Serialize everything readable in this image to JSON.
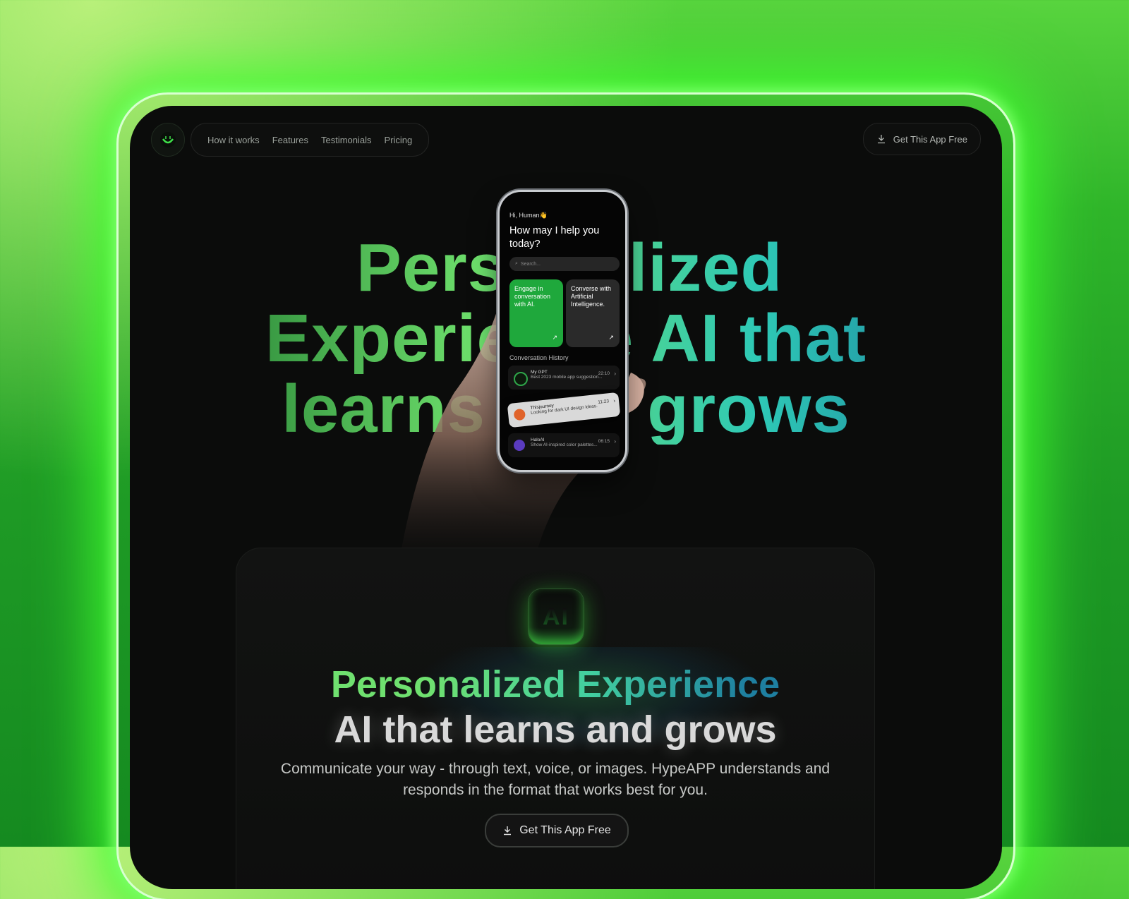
{
  "nav": {
    "logo_icon": "ai-smile-logo-icon",
    "items": [
      "How it works",
      "Features",
      "Testimonials",
      "Pricing"
    ],
    "cta_label": "Get This App Free",
    "cta_icon": "download-icon"
  },
  "hero": {
    "line1": "Personalized",
    "line2": "Experience AI that",
    "line3": "learns and grows"
  },
  "phone": {
    "greeting": "Hi, Human👋",
    "question": "How may I help you today?",
    "search_placeholder": "Search...",
    "card1": "Engage in conversation with AI.",
    "card2": "Converse with Artificial Intelligence.",
    "history_title": "Conversation History",
    "history": [
      {
        "name": "My GPT",
        "time": "22:10",
        "snippet": "Best 2023 mobile app suggestion..."
      },
      {
        "name": "Thisjourney",
        "time": "11:23",
        "snippet": "Looking for dark UI design ideas."
      },
      {
        "name": "HaloAI",
        "time": "06:15",
        "snippet": "Show AI-inspired color palettes..."
      }
    ]
  },
  "feature": {
    "icon_label": "AI",
    "title": "Personalized Experience",
    "subtitle": "AI that learns and grows",
    "description": "Communicate your way - through text, voice, or images. HypeAPP understands and responds in the format that works best for you.",
    "button_label": "Get This App Free"
  },
  "colors": {
    "accent_green": "#1fa83c",
    "glow_green": "#40ff30",
    "teal": "#2ec9b6"
  }
}
